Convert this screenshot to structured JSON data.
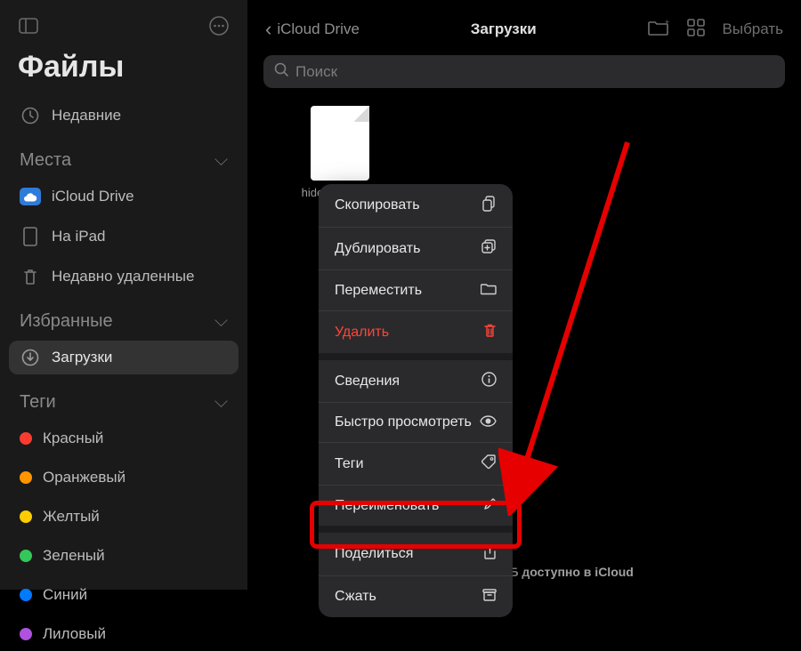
{
  "app_title": "Файлы",
  "recent_label": "Недавние",
  "sections": {
    "places": {
      "header": "Места",
      "items": [
        {
          "label": "iCloud Drive"
        },
        {
          "label": "На iPad"
        },
        {
          "label": "Недавно удаленные"
        }
      ]
    },
    "favorites": {
      "header": "Избранные",
      "items": [
        {
          "label": "Загрузки"
        }
      ]
    },
    "tags": {
      "header": "Теги",
      "items": [
        {
          "label": "Красный",
          "color": "#ff3b30"
        },
        {
          "label": "Оранжевый",
          "color": "#ff9500"
        },
        {
          "label": "Желтый",
          "color": "#ffcc00"
        },
        {
          "label": "Зеленый",
          "color": "#34c759"
        },
        {
          "label": "Синий",
          "color": "#007aff"
        },
        {
          "label": "Лиловый",
          "color": "#af52de"
        }
      ]
    }
  },
  "toolbar": {
    "back_label": "iCloud Drive",
    "title": "Загрузки",
    "select_label": "Выбрать"
  },
  "search": {
    "placeholder": "Поиск"
  },
  "file": {
    "name": "hide-and-seek-c…"
  },
  "context_menu": {
    "copy": "Скопировать",
    "duplicate": "Дублировать",
    "move": "Переместить",
    "delete": "Удалить",
    "info": "Сведения",
    "quicklook": "Быстро просмотреть",
    "tags": "Теги",
    "rename": "Переименовать",
    "share": "Поделиться",
    "compress": "Сжать"
  },
  "status": "1 объект, 4,81 ГБ доступно в iCloud"
}
